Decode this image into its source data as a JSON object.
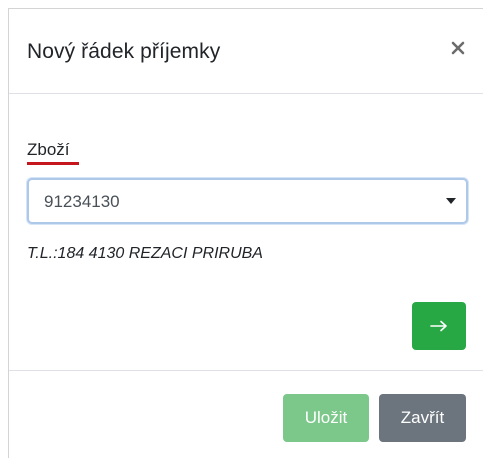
{
  "modal": {
    "title": "Nový řádek příjemky",
    "close_icon": "close-icon"
  },
  "form": {
    "goods_label": "Zboží",
    "goods_value": "91234130",
    "goods_description": "T.L.:184 4130 REZACI PRIRUBA",
    "next_icon": "arrow-right-icon"
  },
  "footer": {
    "save_label": "Uložit",
    "close_label": "Zavřít"
  },
  "colors": {
    "accent_underline": "#c4161c",
    "arrow_button": "#28a745",
    "save_button": "#7bc88a",
    "close_button": "#6c757d",
    "input_focus_border": "#aec8ea"
  }
}
